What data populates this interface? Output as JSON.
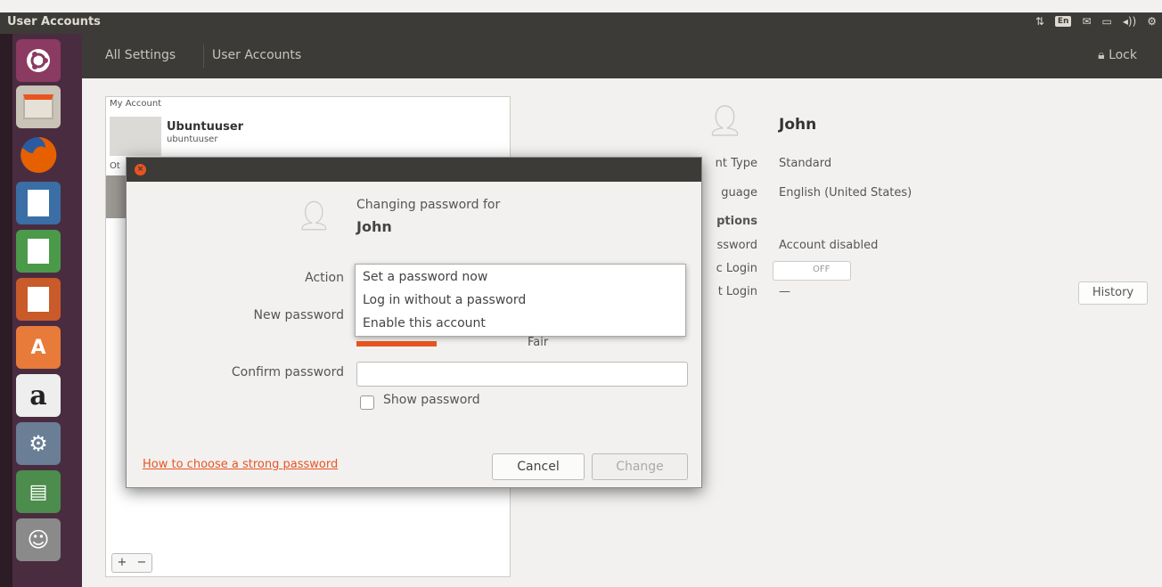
{
  "window": {
    "title": "User Accounts"
  },
  "indicators": {
    "keyboard": "En",
    "volume": "◂))",
    "network": "⇅",
    "mail": "✉",
    "battery": "▭",
    "gear": "⚙"
  },
  "header": {
    "breadcrumbs": [
      "All Settings",
      "User Accounts"
    ],
    "lock_label": "Lock"
  },
  "launcher": {
    "items": [
      "ubuntu-dash",
      "files",
      "firefox",
      "writer",
      "calc",
      "impress",
      "software-center",
      "amazon",
      "settings",
      "more",
      "system-settings"
    ]
  },
  "user_list": {
    "my_account_header": "My Account",
    "current_user": {
      "name": "Ubuntuuser",
      "login": "ubuntuuser"
    },
    "other_header": "Ot",
    "add_label": "+",
    "remove_label": "−"
  },
  "details": {
    "name": "John",
    "rows": [
      {
        "label": "nt Type",
        "value": "Standard"
      },
      {
        "label": "guage",
        "value": "English (United States)"
      },
      {
        "label": "ptions",
        "value": ""
      },
      {
        "label": "ssword",
        "value": "Account disabled"
      },
      {
        "label": "c Login",
        "value": ""
      },
      {
        "label": "t Login",
        "value": "—"
      }
    ],
    "autologin_state": "OFF",
    "history_label": "History"
  },
  "dialog": {
    "heading": "Changing password for",
    "user": "John",
    "action_label": "Action",
    "new_password_label": "New password",
    "confirm_password_label": "Confirm password",
    "confirm_password_value": "",
    "strength_label": "Fair",
    "strength_fraction": 0.25,
    "show_password_label": "Show password",
    "help_link": "How to choose a strong password",
    "cancel_label": "Cancel",
    "change_label": "Change"
  },
  "action_dropdown": {
    "options": [
      "Set a password now",
      "Log in without a password",
      "Enable this account"
    ]
  },
  "colors": {
    "accent": "#e95420",
    "panel": "#3c3b37",
    "launcher": "#4a2c40"
  }
}
